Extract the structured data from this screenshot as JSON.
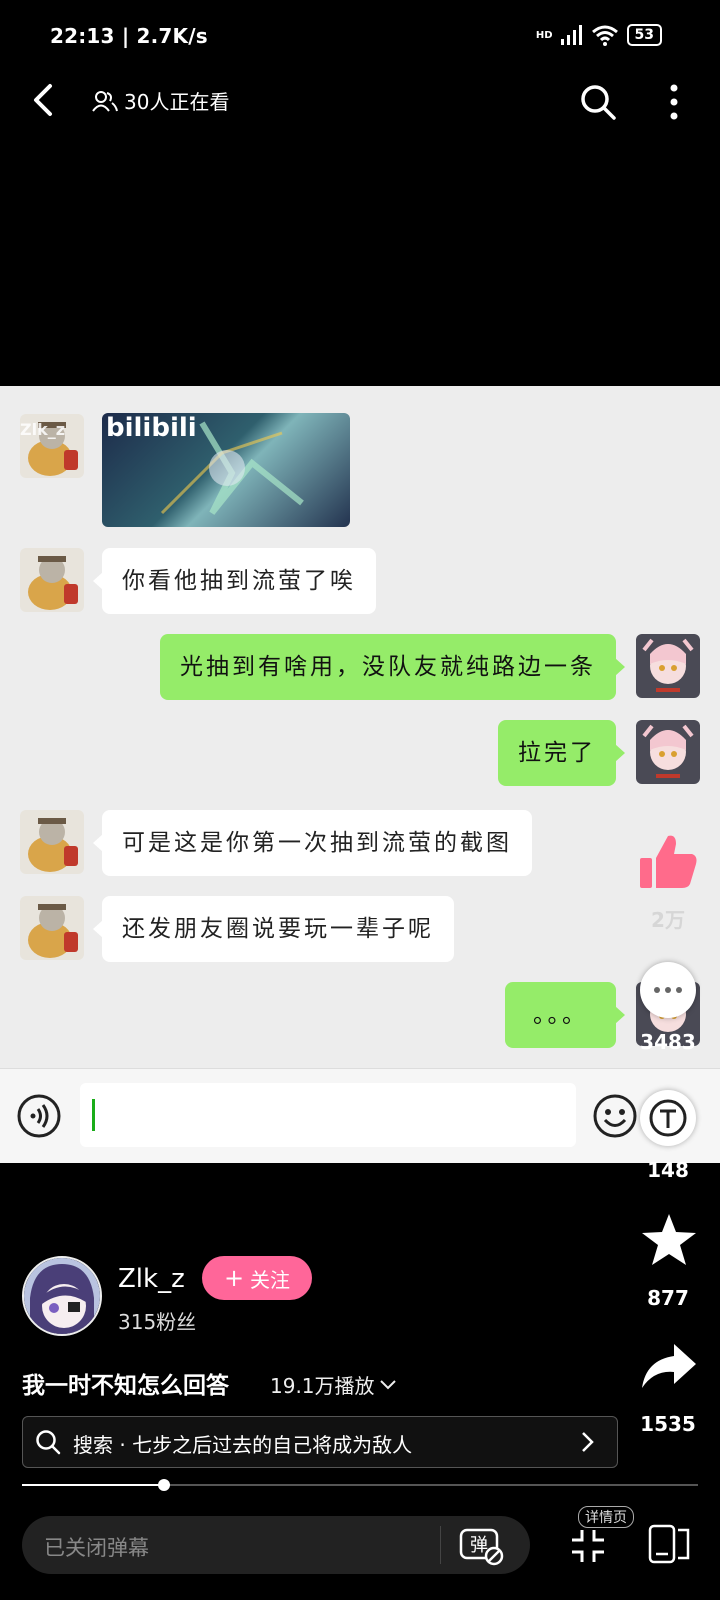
{
  "status_bar": {
    "time": "22:13 | 2.7K/s",
    "network": "HD",
    "battery": "53"
  },
  "top_bar": {
    "viewers": "30人正在看"
  },
  "chat": {
    "messages": [
      {
        "side": "left",
        "type": "image",
        "image_text": "bilibili"
      },
      {
        "side": "left",
        "type": "text",
        "text": "你看他抽到流萤了唉"
      },
      {
        "side": "right",
        "type": "text",
        "text": "光抽到有啥用，没队友就纯路边一条"
      },
      {
        "side": "right",
        "type": "text",
        "text": "拉完了"
      },
      {
        "side": "left",
        "type": "text",
        "text": "可是这是你第一次抽到流萤的截图"
      },
      {
        "side": "left",
        "type": "text",
        "text": "还发朋友圈说要玩一辈子呢"
      },
      {
        "side": "right",
        "type": "text",
        "text": "。。。"
      }
    ],
    "overlay_name": "Zlk_z"
  },
  "actions": {
    "like_count": "2万",
    "comment_count": "3483",
    "coin_count": "148",
    "favorite_count": "877",
    "share_count": "1535"
  },
  "author": {
    "name": "Zlk_z",
    "follow_label": "关注",
    "fans": "315粉丝"
  },
  "video": {
    "title": "我一时不知怎么回答",
    "play_count": "19.1万播放",
    "progress": 0.21
  },
  "search": {
    "text": "搜索 · 七步之后过去的自己将成为敌人"
  },
  "bottom": {
    "danmaku_placeholder": "已关闭弹幕",
    "detail_label": "详情页"
  },
  "colors": {
    "accent": "#ff6699",
    "like": "#ff6b8b",
    "bubble_green": "#95ec69"
  }
}
